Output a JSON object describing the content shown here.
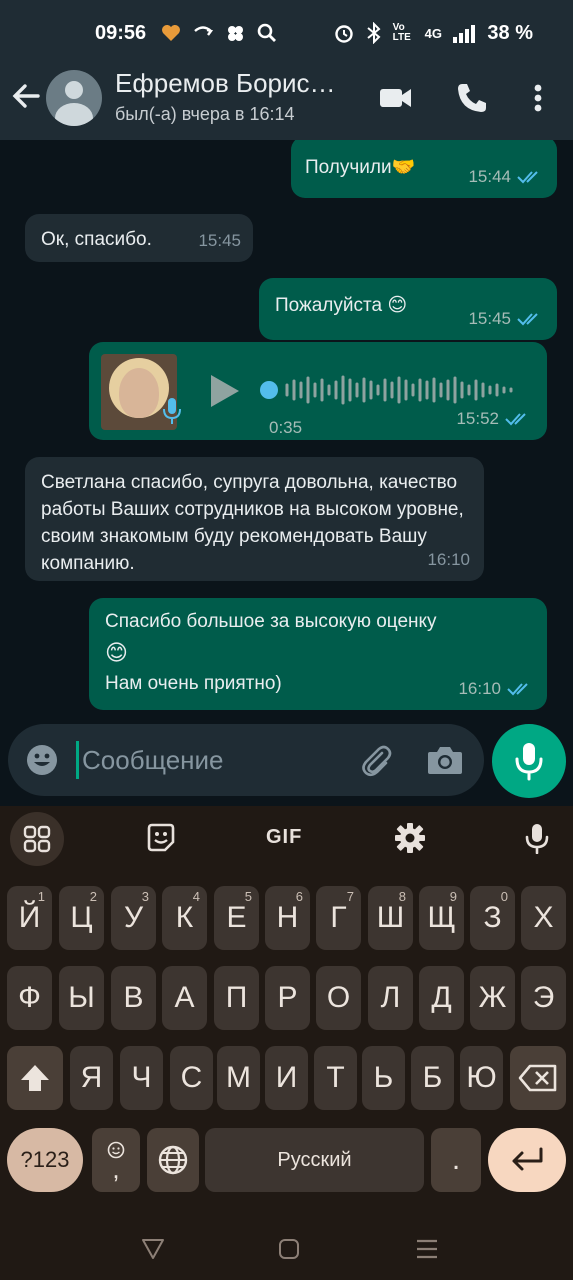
{
  "status_bar": {
    "time": "09:56",
    "network_label": "4G",
    "volte_label": "Vo LTE",
    "battery": "38 %"
  },
  "header": {
    "contact_name": "Ефремов Борис…",
    "last_seen": "был(-а) вчера в 16:14"
  },
  "messages": [
    {
      "direction": "out",
      "text": "Получили🤝",
      "time": "15:44",
      "read": true
    },
    {
      "direction": "in",
      "text": "Ок, спасибо.",
      "time": "15:45"
    },
    {
      "direction": "out",
      "text": "Пожалуйста 😊",
      "time": "15:45",
      "read": true
    },
    {
      "direction": "out",
      "type": "voice",
      "duration": "0:35",
      "time": "15:52",
      "read": true
    },
    {
      "direction": "in",
      "text": "Светлана спасибо, супруга довольна, качество работы Ваших сотрудников на высоком уровне, своим знакомым буду рекомендовать Вашу компанию.",
      "time": "16:10"
    },
    {
      "direction": "out",
      "text_lines": [
        "Спасибо большое за высокую оценку",
        "😊",
        "Нам очень приятно)"
      ],
      "time": "16:10",
      "read": true
    }
  ],
  "composer": {
    "placeholder": "Сообщение"
  },
  "keyboard": {
    "gif_label": "GIF",
    "row1": [
      {
        "key": "Й",
        "hint": "1"
      },
      {
        "key": "Ц",
        "hint": "2"
      },
      {
        "key": "У",
        "hint": "3"
      },
      {
        "key": "К",
        "hint": "4"
      },
      {
        "key": "Е",
        "hint": "5"
      },
      {
        "key": "Н",
        "hint": "6"
      },
      {
        "key": "Г",
        "hint": "7"
      },
      {
        "key": "Ш",
        "hint": "8"
      },
      {
        "key": "Щ",
        "hint": "9"
      },
      {
        "key": "З",
        "hint": "0"
      },
      {
        "key": "Х",
        "hint": ""
      }
    ],
    "row2": [
      "Ф",
      "Ы",
      "В",
      "А",
      "П",
      "Р",
      "О",
      "Л",
      "Д",
      "Ж",
      "Э"
    ],
    "row3": [
      "Я",
      "Ч",
      "С",
      "М",
      "И",
      "Т",
      "Ь",
      "Б",
      "Ю"
    ],
    "symbols_label": "?123",
    "emoji_comma_label": ",",
    "space_label": "Русский",
    "period_label": "."
  },
  "colors": {
    "outgoing_bubble": "#005c4b",
    "incoming_bubble": "#202c33",
    "accent": "#00a884",
    "read_ticks": "#53bdeb"
  }
}
